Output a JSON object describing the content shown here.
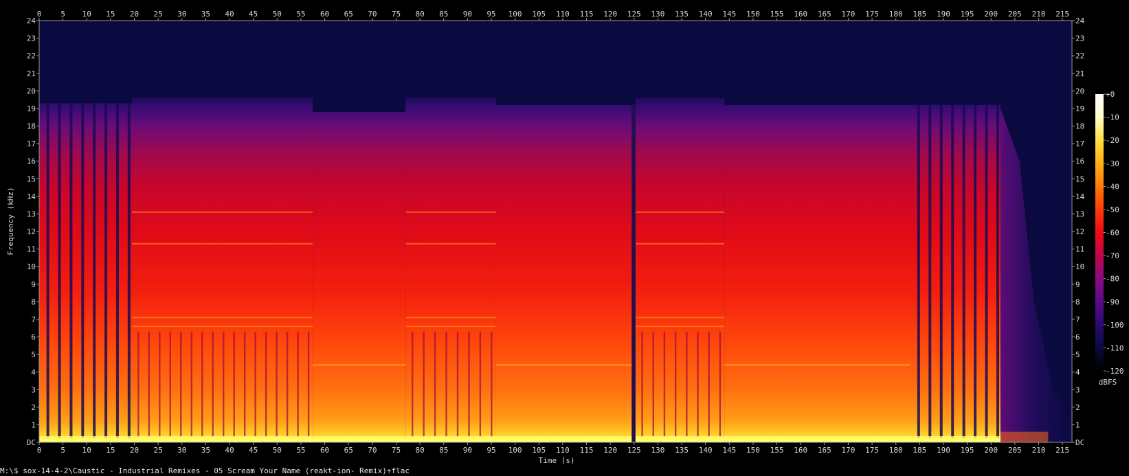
{
  "chart_data": {
    "type": "heatmap",
    "title": "",
    "xlabel": "Time (s)",
    "ylabel": "Frequency (kHz)",
    "xlim": [
      0,
      217
    ],
    "ylim": [
      0,
      24
    ],
    "x_ticks": [
      "0",
      "5",
      "10",
      "15",
      "20",
      "25",
      "30",
      "35",
      "40",
      "45",
      "50",
      "55",
      "60",
      "65",
      "70",
      "75",
      "80",
      "85",
      "90",
      "95",
      "100",
      "105",
      "110",
      "115",
      "120",
      "125",
      "130",
      "135",
      "140",
      "145",
      "150",
      "155",
      "160",
      "165",
      "170",
      "175",
      "180",
      "185",
      "190",
      "195",
      "200",
      "205",
      "210",
      "215"
    ],
    "y_ticks": [
      "DC",
      "1",
      "2",
      "3",
      "4",
      "5",
      "6",
      "7",
      "8",
      "9",
      "10",
      "11",
      "12",
      "13",
      "14",
      "15",
      "16",
      "17",
      "18",
      "19",
      "20",
      "21",
      "22",
      "23",
      "24"
    ],
    "colorbar": {
      "label": "dBFS",
      "ticks": [
        "+0",
        "-10",
        "-20",
        "-30",
        "-40",
        "-50",
        "-60",
        "-70",
        "-80",
        "-90",
        "-100",
        "-110",
        "-120"
      ],
      "range": [
        -120,
        0
      ],
      "colors": [
        "#000000",
        "#0a0a40",
        "#2a0a70",
        "#5a0a8a",
        "#8a0a80",
        "#c0064a",
        "#f00a14",
        "#ff3a08",
        "#ff7a08",
        "#ffb012",
        "#ffe040",
        "#ffffc8",
        "#ffffff"
      ]
    },
    "sections": [
      {
        "start": 0,
        "end": 19.5,
        "cutoff_khz": 19.3,
        "pattern": "pulses"
      },
      {
        "start": 19.5,
        "end": 57.5,
        "cutoff_khz": 19.6,
        "pattern": "dense"
      },
      {
        "start": 57.5,
        "end": 77,
        "cutoff_khz": 18.8,
        "pattern": "sustained"
      },
      {
        "start": 77,
        "end": 96,
        "cutoff_khz": 19.6,
        "pattern": "dense"
      },
      {
        "start": 96,
        "end": 124.5,
        "cutoff_khz": 19.2,
        "pattern": "sustained"
      },
      {
        "start": 124.5,
        "end": 125.3,
        "cutoff_khz": 19.2,
        "pattern": "gap"
      },
      {
        "start": 125.3,
        "end": 144,
        "cutoff_khz": 19.6,
        "pattern": "dense"
      },
      {
        "start": 144,
        "end": 183,
        "cutoff_khz": 19.2,
        "pattern": "sustained"
      },
      {
        "start": 183,
        "end": 202,
        "cutoff_khz": 19.2,
        "pattern": "pulses"
      },
      {
        "start": 202,
        "end": 217,
        "cutoff_khz": 18,
        "pattern": "fade"
      }
    ]
  },
  "footer": {
    "command": "M:\\$ sox-14-4-2\\Caustic - Industrial Remixes - 05 Scream Your Name (reakt-ion- Remix)+flac"
  }
}
